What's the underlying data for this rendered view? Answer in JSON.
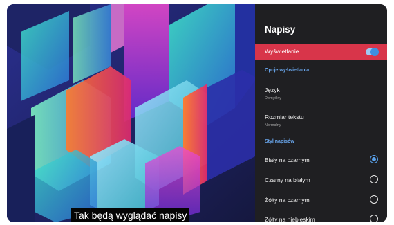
{
  "subtitle_preview": "Tak będą wyglądać napisy",
  "panel": {
    "title": "Napisy",
    "display_row": {
      "label": "Wyświetlanie",
      "toggle_on": true
    },
    "section_display_options": "Opcje wyświetlania",
    "language": {
      "label": "Język",
      "value": "Domyślny"
    },
    "text_size": {
      "label": "Rozmiar tekstu",
      "value": "Normalny"
    },
    "section_style": "Styl napisów",
    "styles": [
      {
        "label": "Biały na czarnym",
        "selected": true
      },
      {
        "label": "Czarny na białym",
        "selected": false
      },
      {
        "label": "Żółty na czarnym",
        "selected": false
      },
      {
        "label": "Żółty na niebieskim",
        "selected": false
      }
    ]
  },
  "colors": {
    "accent": "#d8354a",
    "link": "#6aa8ef",
    "radio": "#5aa2ec",
    "panel_bg": "#1f1f22"
  }
}
